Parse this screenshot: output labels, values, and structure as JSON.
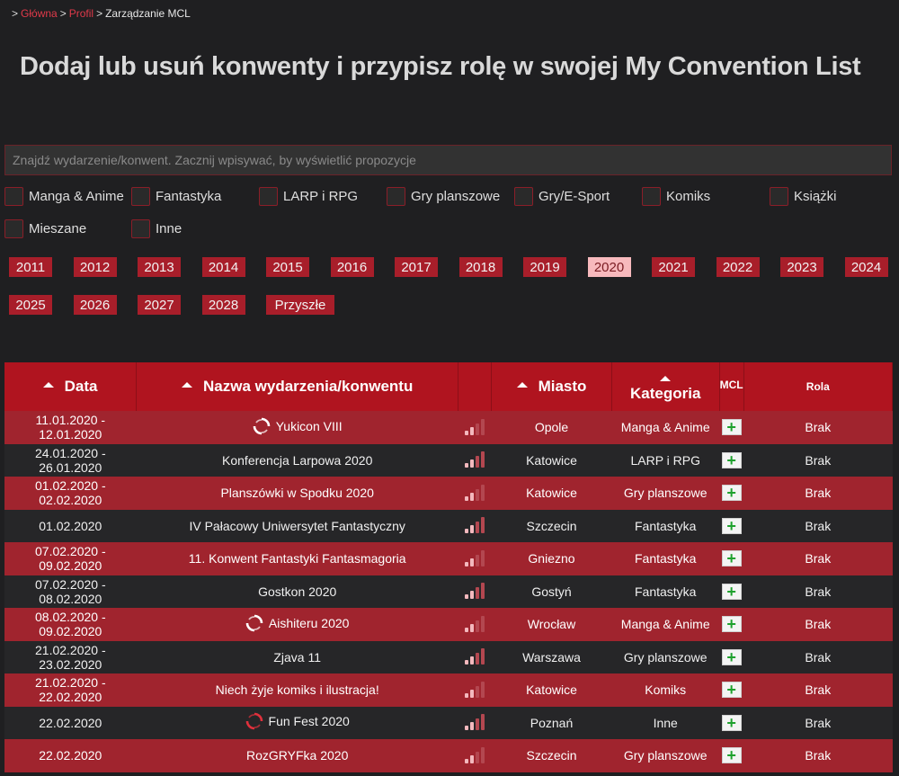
{
  "breadcrumb": {
    "home": "Główna",
    "profile": "Profil",
    "current": "Zarządzanie MCL"
  },
  "title": "Dodaj lub usuń konwenty i przypisz rolę w swojej My Convention List",
  "search": {
    "placeholder": "Znajdź wydarzenie/konwent. Zacznij wpisywać, by wyświetlić propozycje"
  },
  "categories": [
    "Manga & Anime",
    "Fantastyka",
    "LARP i RPG",
    "Gry planszowe",
    "Gry/E-Sport",
    "Komiks",
    "Książki",
    "Mieszane",
    "Inne"
  ],
  "years": [
    "2011",
    "2012",
    "2013",
    "2014",
    "2015",
    "2016",
    "2017",
    "2018",
    "2019",
    "2020",
    "2021",
    "2022",
    "2023",
    "2024",
    "2025",
    "2026",
    "2027",
    "2028",
    "Przyszłe"
  ],
  "active_year": "2020",
  "table": {
    "headers": {
      "date": "Data",
      "name": "Nazwa wydarzenia/konwentu",
      "city": "Miasto",
      "category": "Kategoria",
      "mcl": "MCL",
      "role": "Rola"
    },
    "rows": [
      {
        "date": "11.01.2020 - 12.01.2020",
        "name": "Yukicon VIII",
        "city": "Opole",
        "category": "Manga & Anime",
        "role": "Brak",
        "icon": "spinner-icon"
      },
      {
        "date": "24.01.2020 - 26.01.2020",
        "name": "Konferencja Larpowa 2020",
        "city": "Katowice",
        "category": "LARP i RPG",
        "role": "Brak",
        "icon": ""
      },
      {
        "date": "01.02.2020 - 02.02.2020",
        "name": "Planszówki w Spodku 2020",
        "city": "Katowice",
        "category": "Gry planszowe",
        "role": "Brak",
        "icon": ""
      },
      {
        "date": "01.02.2020",
        "name": "IV Pałacowy Uniwersytet Fantastyczny",
        "city": "Szczecin",
        "category": "Fantastyka",
        "role": "Brak",
        "icon": ""
      },
      {
        "date": "07.02.2020 - 09.02.2020",
        "name": "11. Konwent Fantastyki Fantasmagoria",
        "city": "Gniezno",
        "category": "Fantastyka",
        "role": "Brak",
        "icon": ""
      },
      {
        "date": "07.02.2020 - 08.02.2020",
        "name": "Gostkon 2020",
        "city": "Gostyń",
        "category": "Fantastyka",
        "role": "Brak",
        "icon": ""
      },
      {
        "date": "08.02.2020 - 09.02.2020",
        "name": "Aishiteru 2020",
        "city": "Wrocław",
        "category": "Manga & Anime",
        "role": "Brak",
        "icon": "spinner-icon"
      },
      {
        "date": "21.02.2020 - 23.02.2020",
        "name": "Zjava 11",
        "city": "Warszawa",
        "category": "Gry planszowe",
        "role": "Brak",
        "icon": ""
      },
      {
        "date": "21.02.2020 - 22.02.2020",
        "name": "Niech żyje komiks i ilustracja!",
        "city": "Katowice",
        "category": "Komiks",
        "role": "Brak",
        "icon": ""
      },
      {
        "date": "22.02.2020",
        "name": "Fun Fest 2020",
        "city": "Poznań",
        "category": "Inne",
        "role": "Brak",
        "icon": "spinner-red-icon"
      },
      {
        "date": "22.02.2020",
        "name": "RozGRYFka 2020",
        "city": "Szczecin",
        "category": "Gry planszowe",
        "role": "Brak",
        "icon": ""
      }
    ]
  },
  "colors": {
    "accent": "#b0141f",
    "row_red": "#a0242e",
    "row_dark": "#262628",
    "active_year_bg": "#f7b9bd"
  }
}
